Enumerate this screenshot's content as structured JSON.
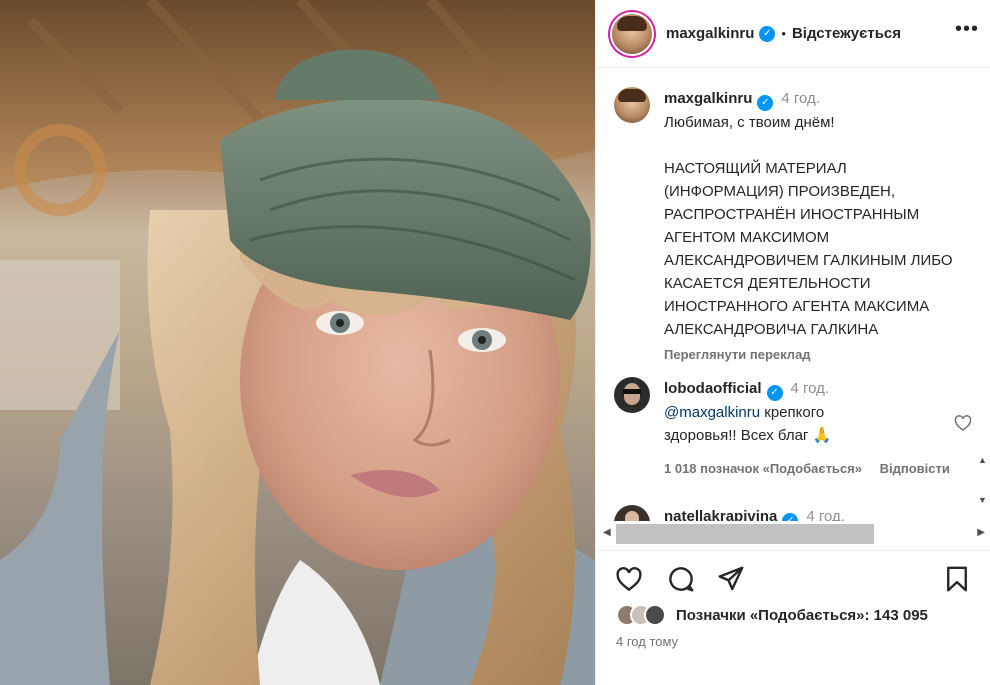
{
  "header": {
    "username": "maxgalkinru",
    "follow_status": "Відстежується",
    "more_icon": "more-horizontal-icon"
  },
  "caption": {
    "username": "maxgalkinru",
    "time": "4 год.",
    "greeting": "Любимая, с твоим днём!",
    "notice": "НАСТОЯЩИЙ МАТЕРИАЛ (ИНФОРМАЦИЯ) ПРОИЗВЕДЕН, РАСПРОСТРАНЁН ИНОСТРАННЫМ АГЕНТОМ МАКСИМОМ АЛЕКСАНДРОВИЧЕМ ГАЛКИНЫМ ЛИБО КАСАЕТСЯ ДЕЯТЕЛЬНОСТИ ИНОСТРАННОГО АГЕНТА МАКСИМА АЛЕКСАНДРОВИЧА ГАЛКИНА",
    "translate": "Переглянути переклад"
  },
  "comments": [
    {
      "username": "lobodaofficial",
      "time": "4 год.",
      "mention": "@maxgalkinru",
      "text": " крепкого здоровья!! Всех благ 🙏",
      "likes": "1 018 позначок «Подобається»",
      "reply": "Відповісти"
    },
    {
      "username": "natellakrapivina",
      "time": "4 год."
    }
  ],
  "footer": {
    "likes_label": "Позначки «Подобається»: 143 095",
    "posted": "4 год тому"
  },
  "colors": {
    "verified": "#0095f6",
    "story_ring": "#d6249f",
    "mention": "#00376b"
  }
}
